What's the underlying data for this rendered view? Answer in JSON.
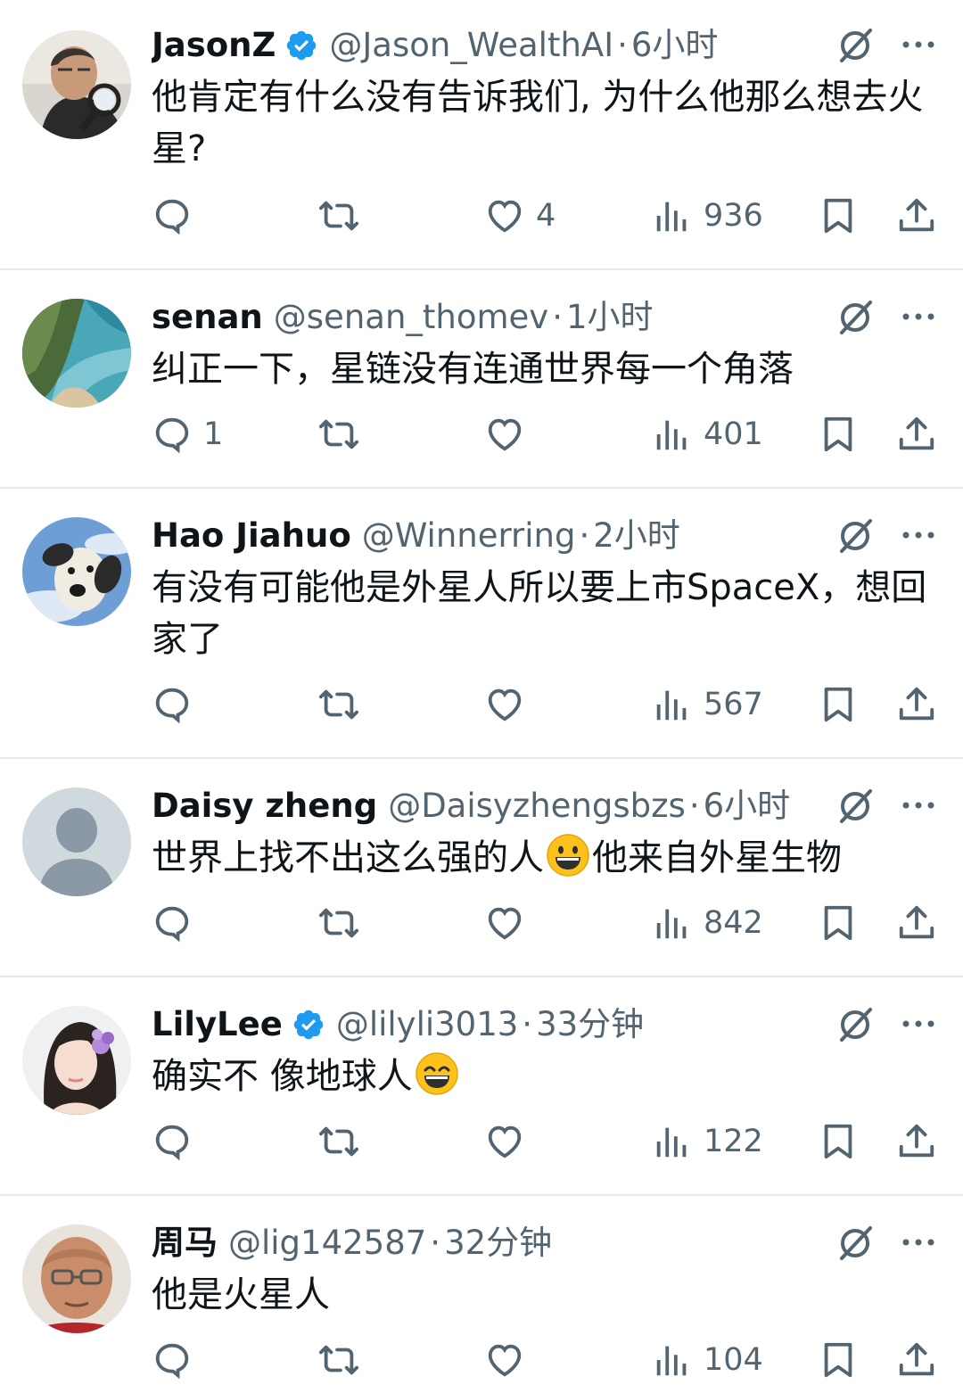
{
  "colors": {
    "text": "#0f1419",
    "secondary": "#536471",
    "verified": "#1d9bf0",
    "divider": "#e6e9ec"
  },
  "icons": {
    "reply": "reply-icon",
    "repost": "repost-icon",
    "like": "like-icon",
    "views": "views-icon",
    "bookmark": "bookmark-icon",
    "share": "share-icon",
    "grok": "grok-icon",
    "more": "more-icon",
    "verified": "verified-badge-icon",
    "emoji": "grinning-face-emoji"
  },
  "posts": [
    {
      "name": "JasonZ",
      "verified": true,
      "handle": "@Jason_WealthAI",
      "separator": "·",
      "time": "6小时",
      "text": "他肯定有什么没有告诉我们, 为什么他那么想去火星?",
      "replies": "",
      "likes": "4",
      "views": "936",
      "avatar": "man-with-magnifying-glass"
    },
    {
      "name": "senan",
      "verified": false,
      "handle": "@senan_thomev",
      "separator": "·",
      "time": "1小时",
      "text": "纠正一下，星链没有连通世界每一个角落",
      "replies": "1",
      "likes": "",
      "views": "401",
      "avatar": "coastline-photo"
    },
    {
      "name": "Hao Jiahuo",
      "verified": false,
      "handle": "@Winnerring",
      "separator": "·",
      "time": "2小时",
      "text": "有没有可能他是外星人所以要上市SpaceX，想回家了",
      "replies": "",
      "likes": "",
      "views": "567",
      "avatar": "cartoon-dog-sky"
    },
    {
      "name": "Daisy zheng",
      "verified": false,
      "handle": "@Daisyzhengsbzs",
      "separator": "·",
      "time": "6小时",
      "text_before": "世界上找不出这么强的人",
      "text_after": "他来自外星生物",
      "replies": "",
      "likes": "",
      "views": "842",
      "avatar": "default-profile"
    },
    {
      "name": "LilyLee",
      "verified": true,
      "handle": "@lilyli3013",
      "separator": "·",
      "time": "33分钟",
      "text_before": "确实不 像地球人",
      "text_after": "",
      "replies": "",
      "likes": "",
      "views": "122",
      "avatar": "woman-with-flower"
    },
    {
      "name": "周马",
      "verified": false,
      "handle": "@lig142587",
      "separator": "·",
      "time": "32分钟",
      "text": "他是火星人",
      "replies": "",
      "likes": "",
      "views": "104",
      "avatar": "old-man-glasses"
    }
  ]
}
